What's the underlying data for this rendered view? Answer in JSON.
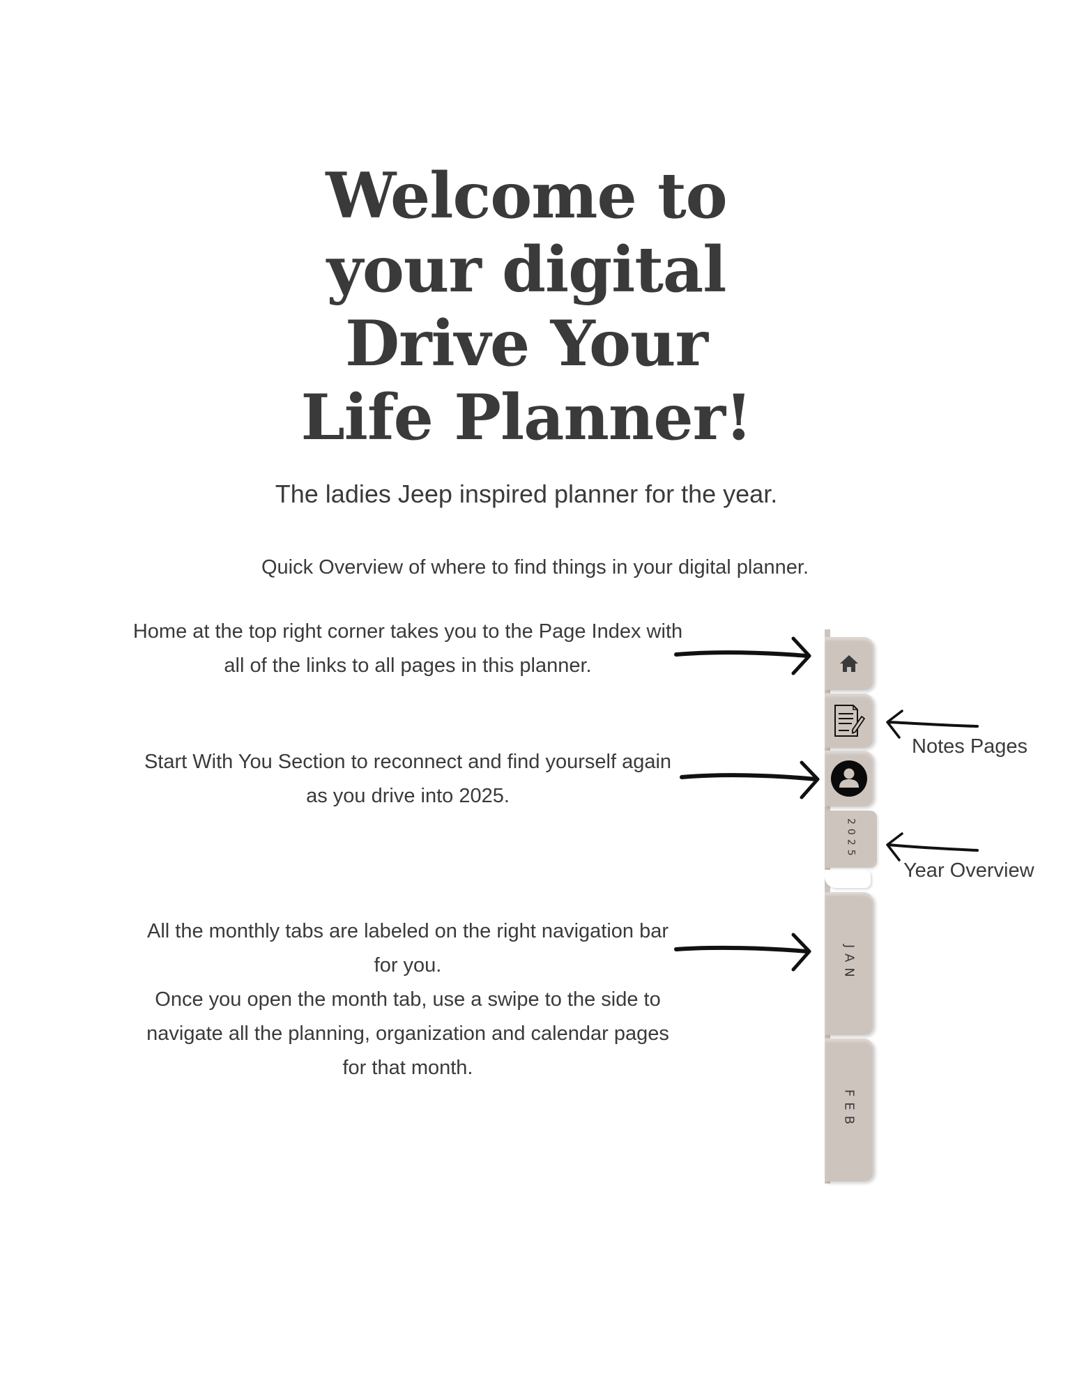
{
  "title": {
    "lines": [
      "Welcome to",
      "your digital",
      "Drive Your",
      "Life Planner!"
    ]
  },
  "subtitle": "The ladies Jeep inspired planner for the year.",
  "overview": "Quick Overview of where to find things in your digital planner.",
  "instructions": [
    {
      "lines": [
        "Home at the top right corner takes you to the Page Index with",
        "all of the links to all pages in this planner."
      ]
    },
    {
      "lines": [
        "Start With You Section to reconnect and find yourself again",
        "as you drive into 2025."
      ]
    },
    {
      "lines": [
        "All the monthly tabs are labeled on the right navigation bar",
        "for you.",
        "Once you open the month tab, use a swipe to the side to",
        "navigate all the planning, organization and calendar pages",
        "for that month."
      ]
    }
  ],
  "side_labels": {
    "notes": "Notes Pages",
    "year": "Year Overview"
  },
  "nav_tabs": [
    {
      "id": "home",
      "icon": "home-icon"
    },
    {
      "id": "notes",
      "icon": "notes-pencil-icon"
    },
    {
      "id": "start-with-you",
      "icon": "user-circle-icon"
    },
    {
      "id": "year",
      "label": "2025"
    },
    {
      "id": "jan",
      "label": "JAN"
    },
    {
      "id": "feb",
      "label": "FEB"
    }
  ],
  "colors": {
    "tab": "#cdc4be",
    "text": "#3a3a3a",
    "arrow": "#111111"
  }
}
